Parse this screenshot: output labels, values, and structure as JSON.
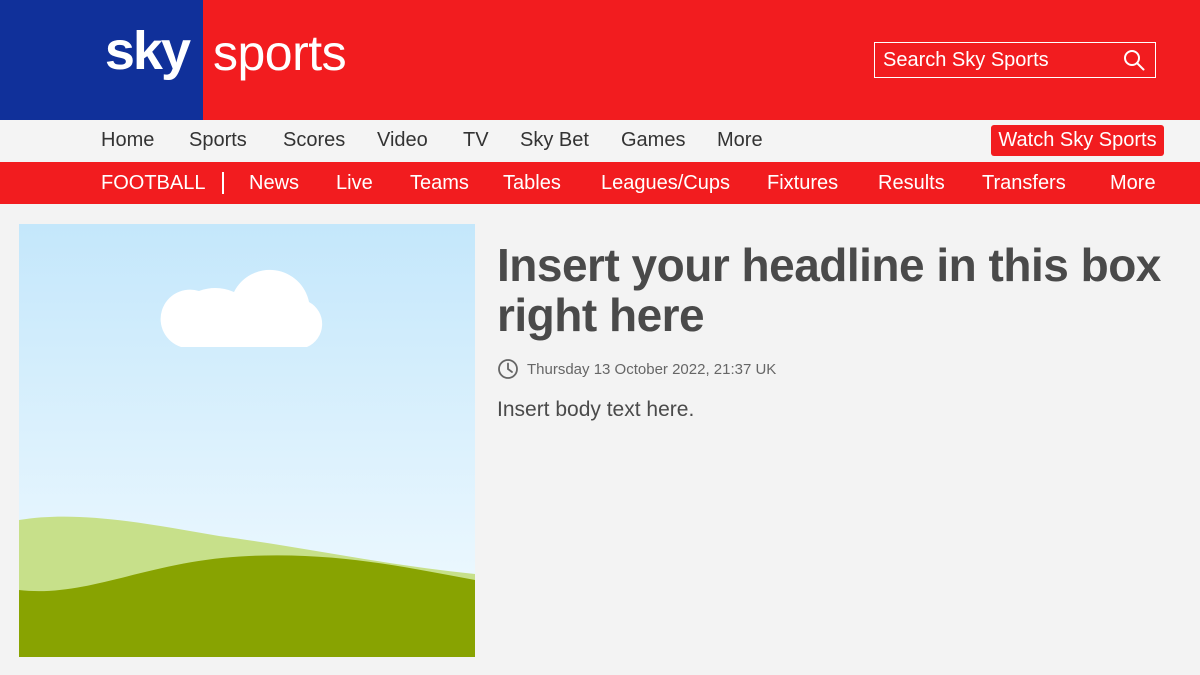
{
  "header": {
    "logo_sky": "sky",
    "logo_sports": "sports",
    "search_placeholder": "Search Sky Sports",
    "colors": {
      "brand_red": "#f21c1f",
      "brand_blue": "#10309a"
    }
  },
  "nav_primary": {
    "items": [
      "Home",
      "Sports",
      "Scores",
      "Video",
      "TV",
      "Sky Bet",
      "Games",
      "More"
    ],
    "cta": "Watch Sky Sports"
  },
  "nav_secondary": {
    "section": "FOOTBALL",
    "items": [
      "News",
      "Live",
      "Teams",
      "Tables",
      "Leagues/Cups",
      "Fixtures",
      "Results",
      "Transfers",
      "More"
    ]
  },
  "article": {
    "headline": "Insert your headline in this box right here",
    "timestamp": "Thursday 13 October 2022, 21:37 UK",
    "body": "Insert body text here.",
    "image_icon": "landscape-placeholder-image"
  }
}
